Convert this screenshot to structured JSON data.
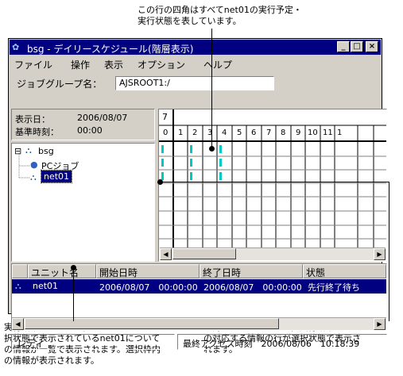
{
  "annotations": {
    "top": "この行の四角はすべてnet01の実行予定・\n実行状態を表しています。",
    "left": "実行結果リストには，ツリーエリアで選\n択状態で表示されているnet01について\nの情報が一覧で表示されます。選択枠内\nの情報が表示されます。",
    "right": "四角をクリックすると，実行結果リスト\nの対応する情報の行が選択状態で表示さ\nれます。"
  },
  "window": {
    "title": "bsg - デイリースケジュール(階層表示)",
    "minimize": "_",
    "maximize": "□",
    "close": "×"
  },
  "menu": [
    "ファイル",
    "操作",
    "表示",
    "オプション",
    "ヘルプ"
  ],
  "jobgroup": {
    "label": "ジョブグループ名：",
    "value": "AJSROOT1:/"
  },
  "dates": {
    "display_label": "表示日：",
    "display_value": "2006/08/07",
    "base_label": "基準時刻：",
    "base_value": "00:00"
  },
  "tree": {
    "root": "bsg",
    "child1": "PCジョブ",
    "child2": "net01",
    "root_toggle": "⊟"
  },
  "gantt": {
    "day": "7",
    "hours": [
      "0",
      "1",
      "2",
      "3",
      "4",
      "5",
      "6",
      "7",
      "8",
      "9",
      "10",
      "11",
      "1"
    ],
    "marker_color": "#00c8c8",
    "left_arrow": "◀",
    "right_arrow": "▶"
  },
  "results": {
    "headers": [
      "ユニット名",
      "開始日時",
      "終了日時",
      "状態"
    ],
    "row": {
      "unit": "net01",
      "start": "2006/08/07　00:00:00",
      "end": "2006/08/07　00:00:00",
      "status": "先行終了待ち"
    },
    "left_arrow": "◀",
    "right_arrow": "▶"
  },
  "status": {
    "left": "レディ",
    "right": "最終アクセス時刻　2006/08/06　10:18:39"
  },
  "colors": {
    "titlebar": "#000080",
    "selection": "#000080",
    "face": "#d4d0c8"
  }
}
